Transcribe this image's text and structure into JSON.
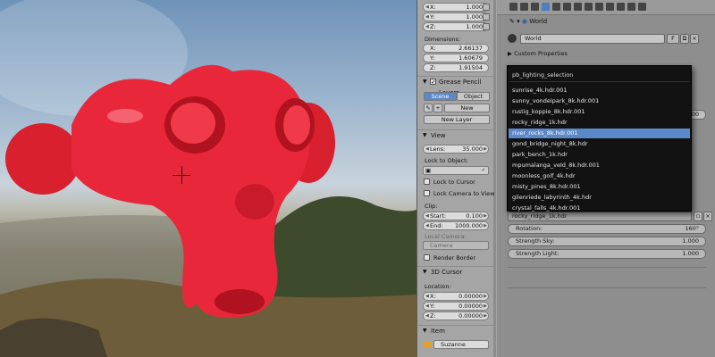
{
  "npanel": {
    "x_top": {
      "label": "X:",
      "value": "1.000"
    },
    "y_top": {
      "label": "Y:",
      "value": "1.000"
    },
    "z_top": {
      "label": "Z:",
      "value": "1.000"
    },
    "dimensions_label": "Dimensions:",
    "dim_x": {
      "label": "X:",
      "value": "2.66137"
    },
    "dim_y": {
      "label": "Y:",
      "value": "1.60679"
    },
    "dim_z": {
      "label": "Z:",
      "value": "1.91504"
    },
    "grease_pencil_title": "Grease Pencil Layers",
    "gp_tab_scene": "Scene",
    "gp_tab_object": "Object",
    "gp_new": "New",
    "gp_new_layer": "New Layer",
    "view_title": "View",
    "lens": {
      "label": "Lens:",
      "value": "35.000"
    },
    "lock_to_object": "Lock to Object:",
    "lock_to_cursor": "Lock to Cursor",
    "lock_camera_to_view": "Lock Camera to View",
    "clip_label": "Clip:",
    "clip_start": {
      "label": "Start:",
      "value": "0.100"
    },
    "clip_end": {
      "label": "End:",
      "value": "1000.000"
    },
    "local_camera_label": "Local Camera:",
    "camera_field": "Camera",
    "render_border": "Render Border",
    "cursor3d_title": "3D Cursor",
    "location_label": "Location:",
    "loc_x": {
      "label": "X:",
      "value": "0.00000"
    },
    "loc_y": {
      "label": "Y:",
      "value": "0.00000"
    },
    "loc_z": {
      "label": "Z:",
      "value": "0.00000"
    },
    "item_title": "Item",
    "item_name": "Suzanne"
  },
  "properties": {
    "breadcrumb_world": "World",
    "world_field": "World",
    "world_f_button": "F",
    "custom_properties": "Custom Properties",
    "right_value": "1.000",
    "selected_hdr": "rocky_ridge_1k.hdr",
    "rotation": {
      "label": "Rotation:",
      "value": "160°"
    },
    "strength_sky": {
      "label": "Strength Sky:",
      "value": "1.000"
    },
    "strength_light": {
      "label": "Strength Light:",
      "value": "1.000"
    }
  },
  "dropdown": {
    "title": "pb_lighting_selection",
    "options": [
      "sunrise_4k.hdr.001",
      "sunny_vondelpark_8k.hdr.001",
      "rustig_koppie_8k.hdr.001",
      "rocky_ridge_1k.hdr",
      "river_rocks_8k.hdr.001",
      "gond_bridge_night_8k.hdr",
      "park_bench_1k.hdr",
      "mpumalanga_veld_8k.hdr.001",
      "moonless_golf_4k.hdr",
      "misty_pines_8k.hdr.001",
      "gilenriede_labyrinth_4k.hdr",
      "crystal_falls_4k.hdr.001"
    ],
    "selected_index": 4
  },
  "colors": {
    "accent": "#5b88c9",
    "monkey_red": "#e8283a"
  }
}
